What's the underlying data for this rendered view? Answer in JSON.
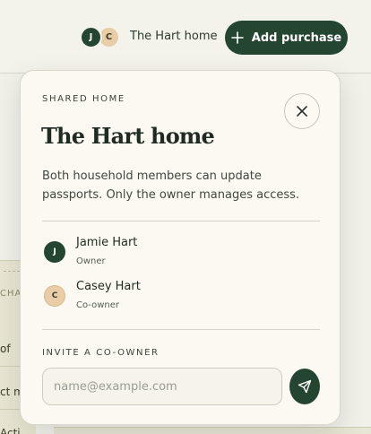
{
  "header": {
    "avatars": [
      {
        "initial": "J",
        "color": "#24452f"
      },
      {
        "initial": "C",
        "color": "#e8cda7"
      }
    ],
    "home_title": "The Hart home",
    "add_purchase_label": "Add purchase",
    "add_icon": "plus-icon"
  },
  "background": {
    "column_header_fragment": "CHA",
    "row_fragments": [
      "of",
      "ct m",
      "Acti"
    ]
  },
  "popover": {
    "eyebrow": "SHARED HOME",
    "title": "The Hart home",
    "description": "Both household members can update passports. Only the owner manages access.",
    "close_icon": "close-icon",
    "members": [
      {
        "initial": "J",
        "name": "Jamie Hart",
        "role": "Owner",
        "color": "#24452f"
      },
      {
        "initial": "C",
        "name": "Casey Hart",
        "role": "Co-owner",
        "color": "#e8cda7"
      }
    ],
    "invite": {
      "label": "INVITE A CO-OWNER",
      "placeholder": "name@example.com",
      "value": "",
      "send_icon": "send-icon"
    }
  },
  "colors": {
    "accent": "#24452f",
    "surface": "#fbf9f1",
    "page": "#f1f1ea"
  }
}
